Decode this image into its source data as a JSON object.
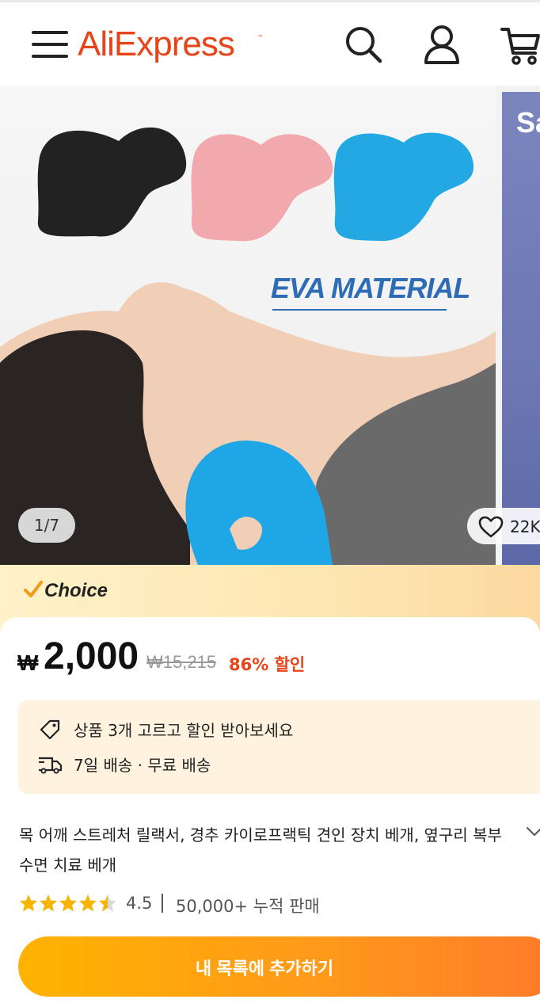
{
  "header": {
    "logo_text": "AliExpress",
    "logo_tm": "™",
    "icons": [
      "menu-icon",
      "search-icon",
      "account-icon",
      "cart-icon"
    ],
    "brand_color": "#e8441a"
  },
  "gallery": {
    "pager": "1/7",
    "image_text": "EVA MATERIAL",
    "next_image_text": "Sa",
    "wishlist_count": "22K"
  },
  "choice": {
    "label": "Choice",
    "icon": "checkmark-icon"
  },
  "price": {
    "currency": "₩",
    "current": "2,000",
    "original": "₩15,215",
    "discount": "86% 할인",
    "discount_color": "#e8441a"
  },
  "promo": {
    "items": [
      {
        "icon": "tag-icon",
        "text": "상품 3개 고르고 할인 받아보세요"
      },
      {
        "icon": "truck-icon",
        "text": "7일 배송 · 무료 배송"
      }
    ]
  },
  "product": {
    "title": "목 어깨 스트레처 릴랙서, 경추 카이로프랙틱 견인 장치 베개, 옆구리 복부 수면 치료 베개",
    "rating": "4.5",
    "rating_stars": 4.5,
    "separator": "|",
    "sold": "50,000+ 누적 판매"
  },
  "cta": {
    "label": "내 목록에 추가하기",
    "gradient": [
      "#ffb300",
      "#ff7a2a"
    ]
  }
}
